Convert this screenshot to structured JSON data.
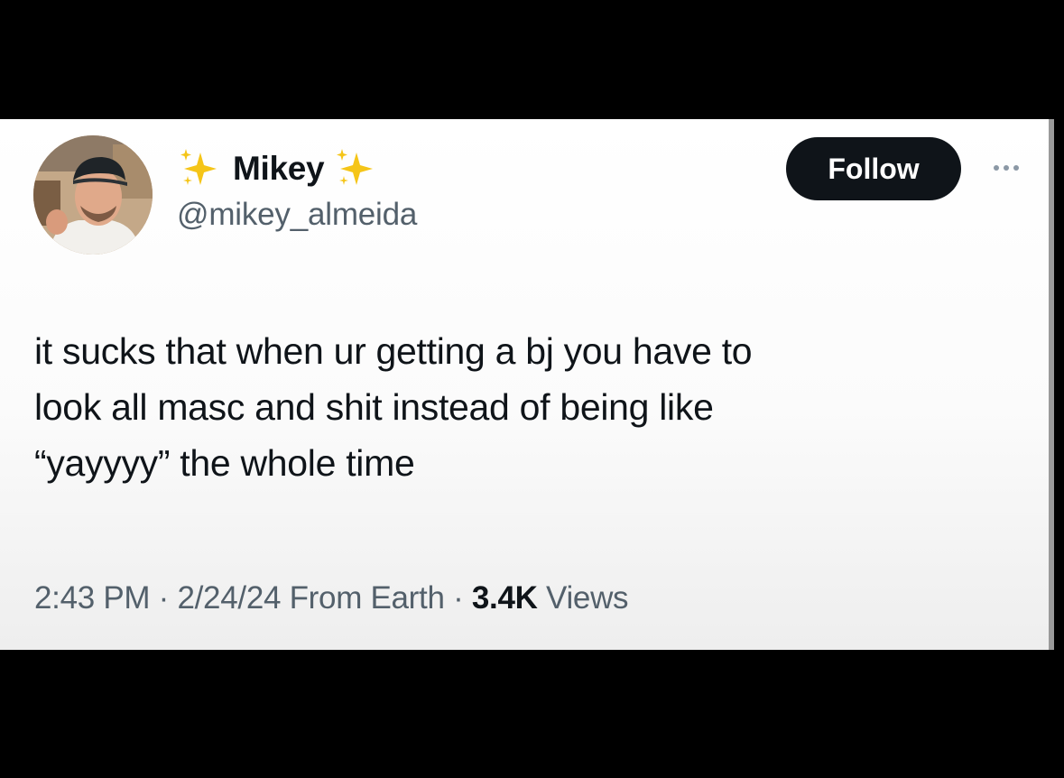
{
  "user": {
    "display_name": "Mikey",
    "handle": "@mikey_almeida",
    "name_decoration_icon": "sparkles-icon"
  },
  "actions": {
    "follow_label": "Follow",
    "more_icon": "more-horizontal-icon"
  },
  "tweet": {
    "text_lines": [
      "it sucks that when ur getting a bj you have to",
      "look all masc and shit instead of being like",
      "“yayyyy” the whole time"
    ]
  },
  "meta": {
    "time": "2:43 PM",
    "separator": " · ",
    "date": "2/24/24",
    "source": "From Earth",
    "views_count": "3.4K",
    "views_label": "Views"
  },
  "colors": {
    "text_primary": "#0f1419",
    "text_secondary": "#53606b",
    "follow_bg": "#0f1419",
    "sparkle": "#f5c518"
  }
}
